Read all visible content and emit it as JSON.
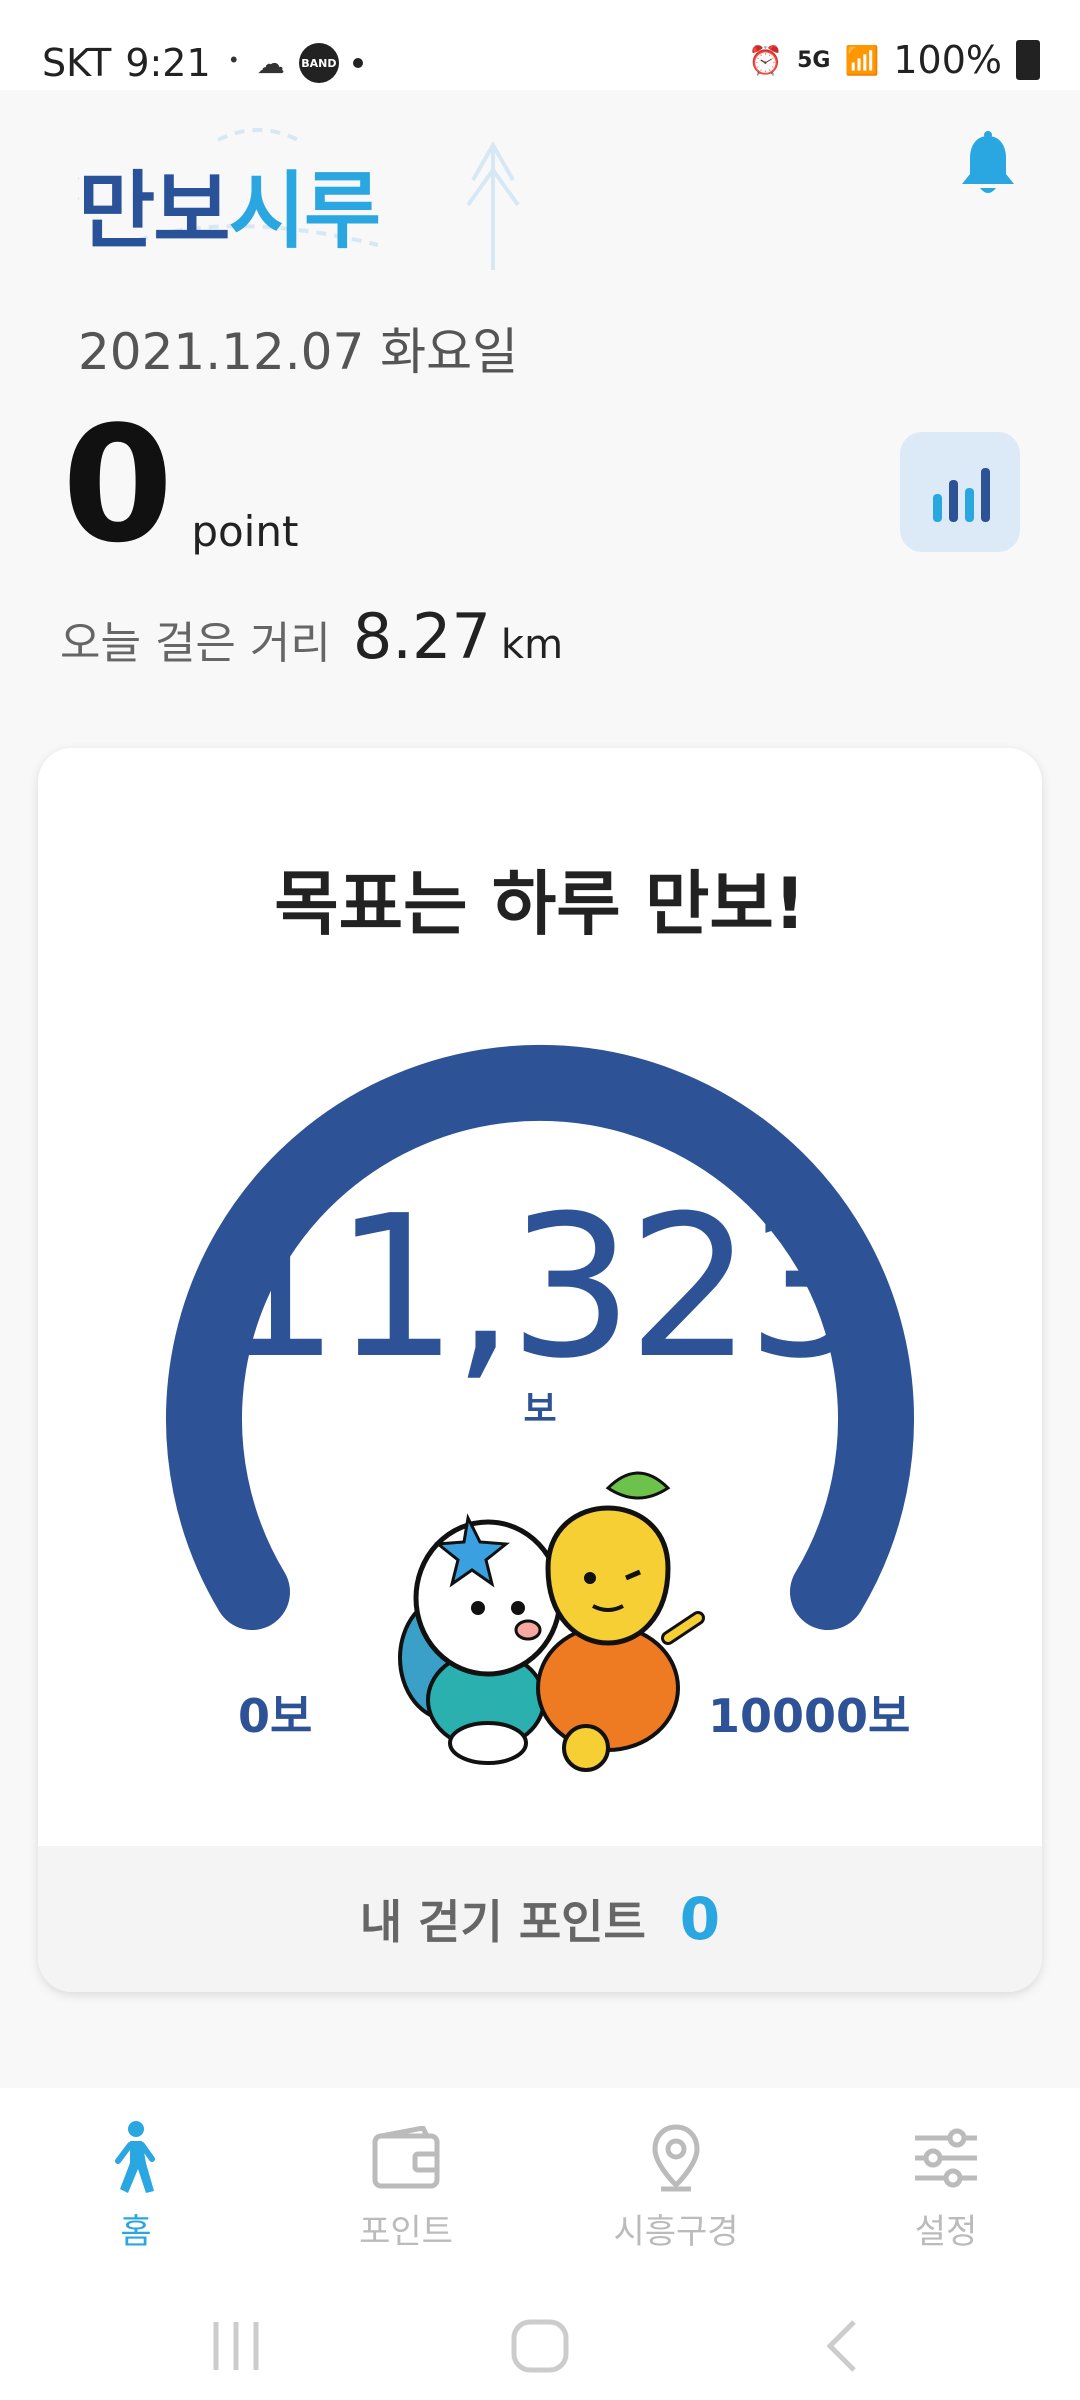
{
  "status_bar": {
    "carrier": "SKT",
    "time": "9:21",
    "band_label": "BAND",
    "network": "5G",
    "battery": "100%"
  },
  "header": {
    "logo_part1": "만보",
    "logo_part2": "시루"
  },
  "summary": {
    "date": "2021.12.07 화요일",
    "points": "0",
    "points_unit": "point",
    "distance_label": "오늘 걸은 거리",
    "distance_value": "8.27",
    "distance_unit": "km"
  },
  "card": {
    "title": "목표는 하루 만보!",
    "steps": "11,323",
    "steps_unit": "보",
    "min_label": "0보",
    "max_label": "10000보",
    "footer_label": "내 걷기 포인트",
    "footer_value": "0"
  },
  "nav": {
    "home": "홈",
    "points": "포인트",
    "sights": "시흥구경",
    "settings": "설정"
  },
  "colors": {
    "primary_blue": "#2e5296",
    "accent_blue": "#2aa6e0"
  }
}
